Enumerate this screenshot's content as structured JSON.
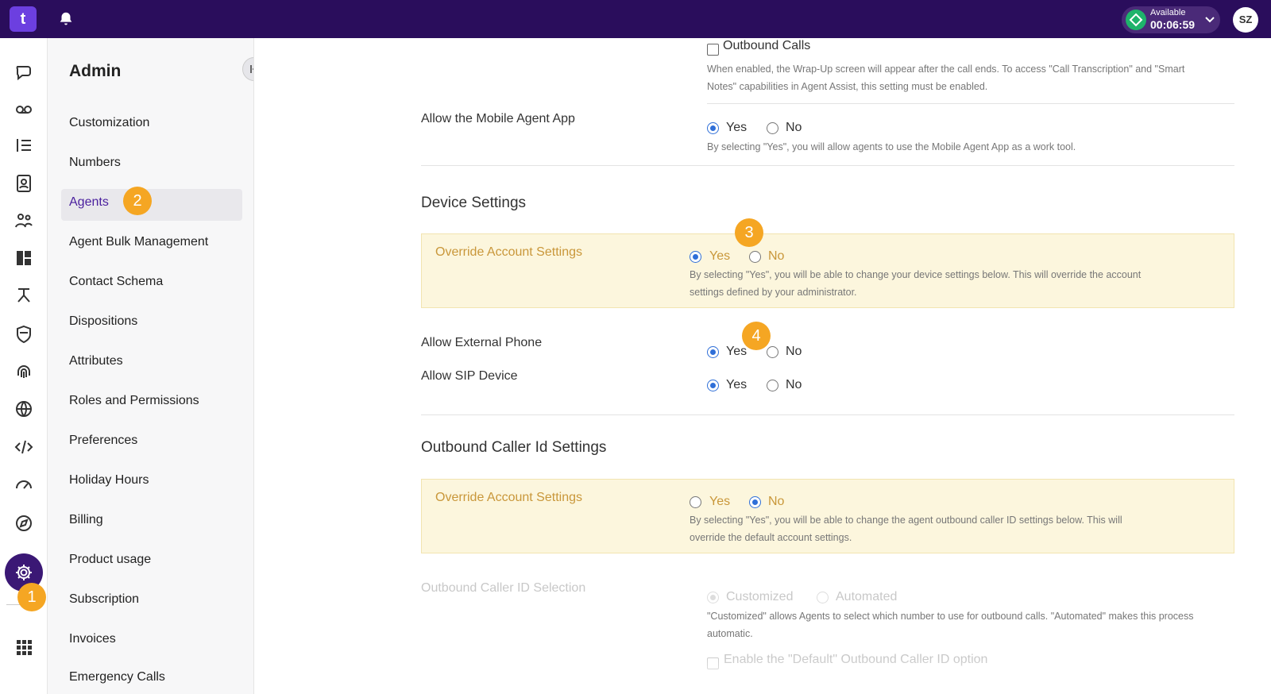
{
  "topbar": {
    "logo_text": "t",
    "status_label": "Available",
    "status_time": "00:06:59",
    "avatar_initials": "SZ",
    "colors": {
      "bar": "#2a0d5c",
      "available": "#1eb36b"
    }
  },
  "rail": {
    "icons": [
      "chat-bubble-icon",
      "voicemail-icon",
      "list-icon",
      "contacts-icon",
      "team-icon",
      "dashboard-icon",
      "flow-icon",
      "shield-icon",
      "fingerprint-icon",
      "globe-icon",
      "code-icon",
      "speedometer-icon",
      "compass-icon",
      "settings-icon",
      "apps-grid-icon"
    ],
    "active": "settings-icon"
  },
  "sidebar": {
    "title": "Admin",
    "items": [
      {
        "label": "Customization"
      },
      {
        "label": "Numbers"
      },
      {
        "label": "Agents"
      },
      {
        "label": "Agent Bulk Management"
      },
      {
        "label": "Contact Schema"
      },
      {
        "label": "Dispositions"
      },
      {
        "label": "Attributes"
      },
      {
        "label": "Roles and Permissions"
      },
      {
        "label": "Preferences"
      },
      {
        "label": "Holiday Hours"
      },
      {
        "label": "Billing"
      },
      {
        "label": "Product usage"
      },
      {
        "label": "Subscription"
      },
      {
        "label": "Invoices"
      },
      {
        "label": "Emergency Calls"
      }
    ],
    "active_item": "Agents"
  },
  "badges": [
    "1",
    "2",
    "3",
    "4"
  ],
  "main": {
    "outbound_calls_label": "Outbound Calls",
    "outbound_calls_help_1": "When enabled, the Wrap-Up screen will appear after the call ends. To access \"Call Transcription\" and \"Smart",
    "outbound_calls_help_2": "Notes\" capabilities in Agent Assist, this setting must be enabled.",
    "mobile_app": {
      "label": "Allow the Mobile Agent App",
      "yes": "Yes",
      "no": "No",
      "selected": "Yes",
      "help": "By selecting \"Yes\", you will allow agents to use the Mobile Agent App as a work tool."
    },
    "device_settings": {
      "title": "Device Settings",
      "override_label": "Override Account Settings",
      "yes": "Yes",
      "no": "No",
      "selected": "Yes",
      "help_1": "By selecting \"Yes\", you will be able to change your device settings below. This will override the account",
      "help_2": "settings defined by your administrator.",
      "external_phone": {
        "label": "Allow External Phone",
        "yes": "Yes",
        "no": "No",
        "selected": "Yes"
      },
      "sip_device": {
        "label": "Allow SIP Device",
        "yes": "Yes",
        "no": "No",
        "selected": "Yes"
      }
    },
    "caller_id_settings": {
      "title": "Outbound Caller Id Settings",
      "override_label": "Override Account Settings",
      "yes": "Yes",
      "no": "No",
      "selected": "No",
      "help_1": "By selecting \"Yes\", you will be able to change the agent outbound caller ID settings below. This will",
      "help_2": "override the default account settings.",
      "selection": {
        "label": "Outbound Caller ID Selection",
        "customized": "Customized",
        "automated": "Automated",
        "selected": "Customized",
        "help_1": "\"Customized\" allows Agents to select which number to use for outbound calls. \"Automated\" makes this process",
        "help_2": "automatic."
      },
      "default_option_label": "Enable the \"Default\" Outbound Caller ID option"
    }
  }
}
